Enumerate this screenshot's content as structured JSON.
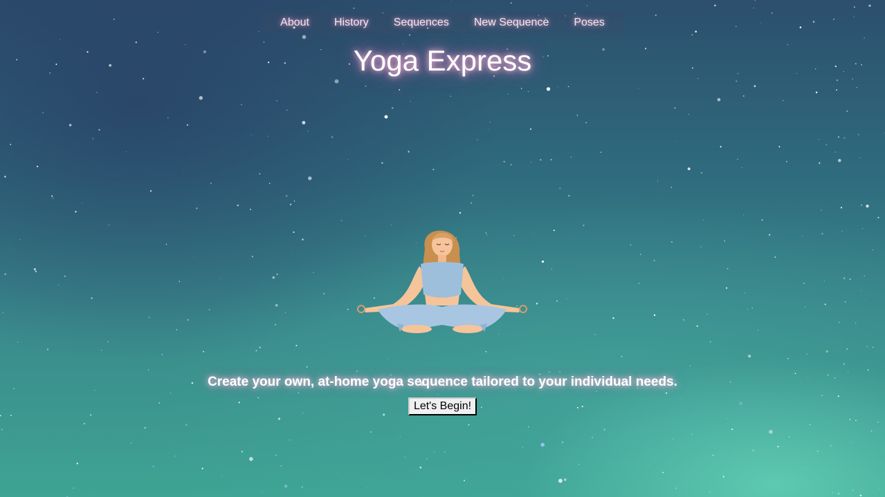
{
  "nav": {
    "items": [
      {
        "label": "About"
      },
      {
        "label": "History"
      },
      {
        "label": "Sequences"
      },
      {
        "label": "New Sequence"
      },
      {
        "label": "Poses"
      }
    ]
  },
  "hero": {
    "title": "Yoga Express",
    "tagline": "Create your own, at-home yoga sequence tailored to your individual needs.",
    "begin_label": "Let's Begin!"
  },
  "colors": {
    "title_glow": "#ff78be",
    "nav_text": "#f3e6f0",
    "sky_top": "#2c4f6d",
    "sky_bottom": "#3ea493"
  }
}
